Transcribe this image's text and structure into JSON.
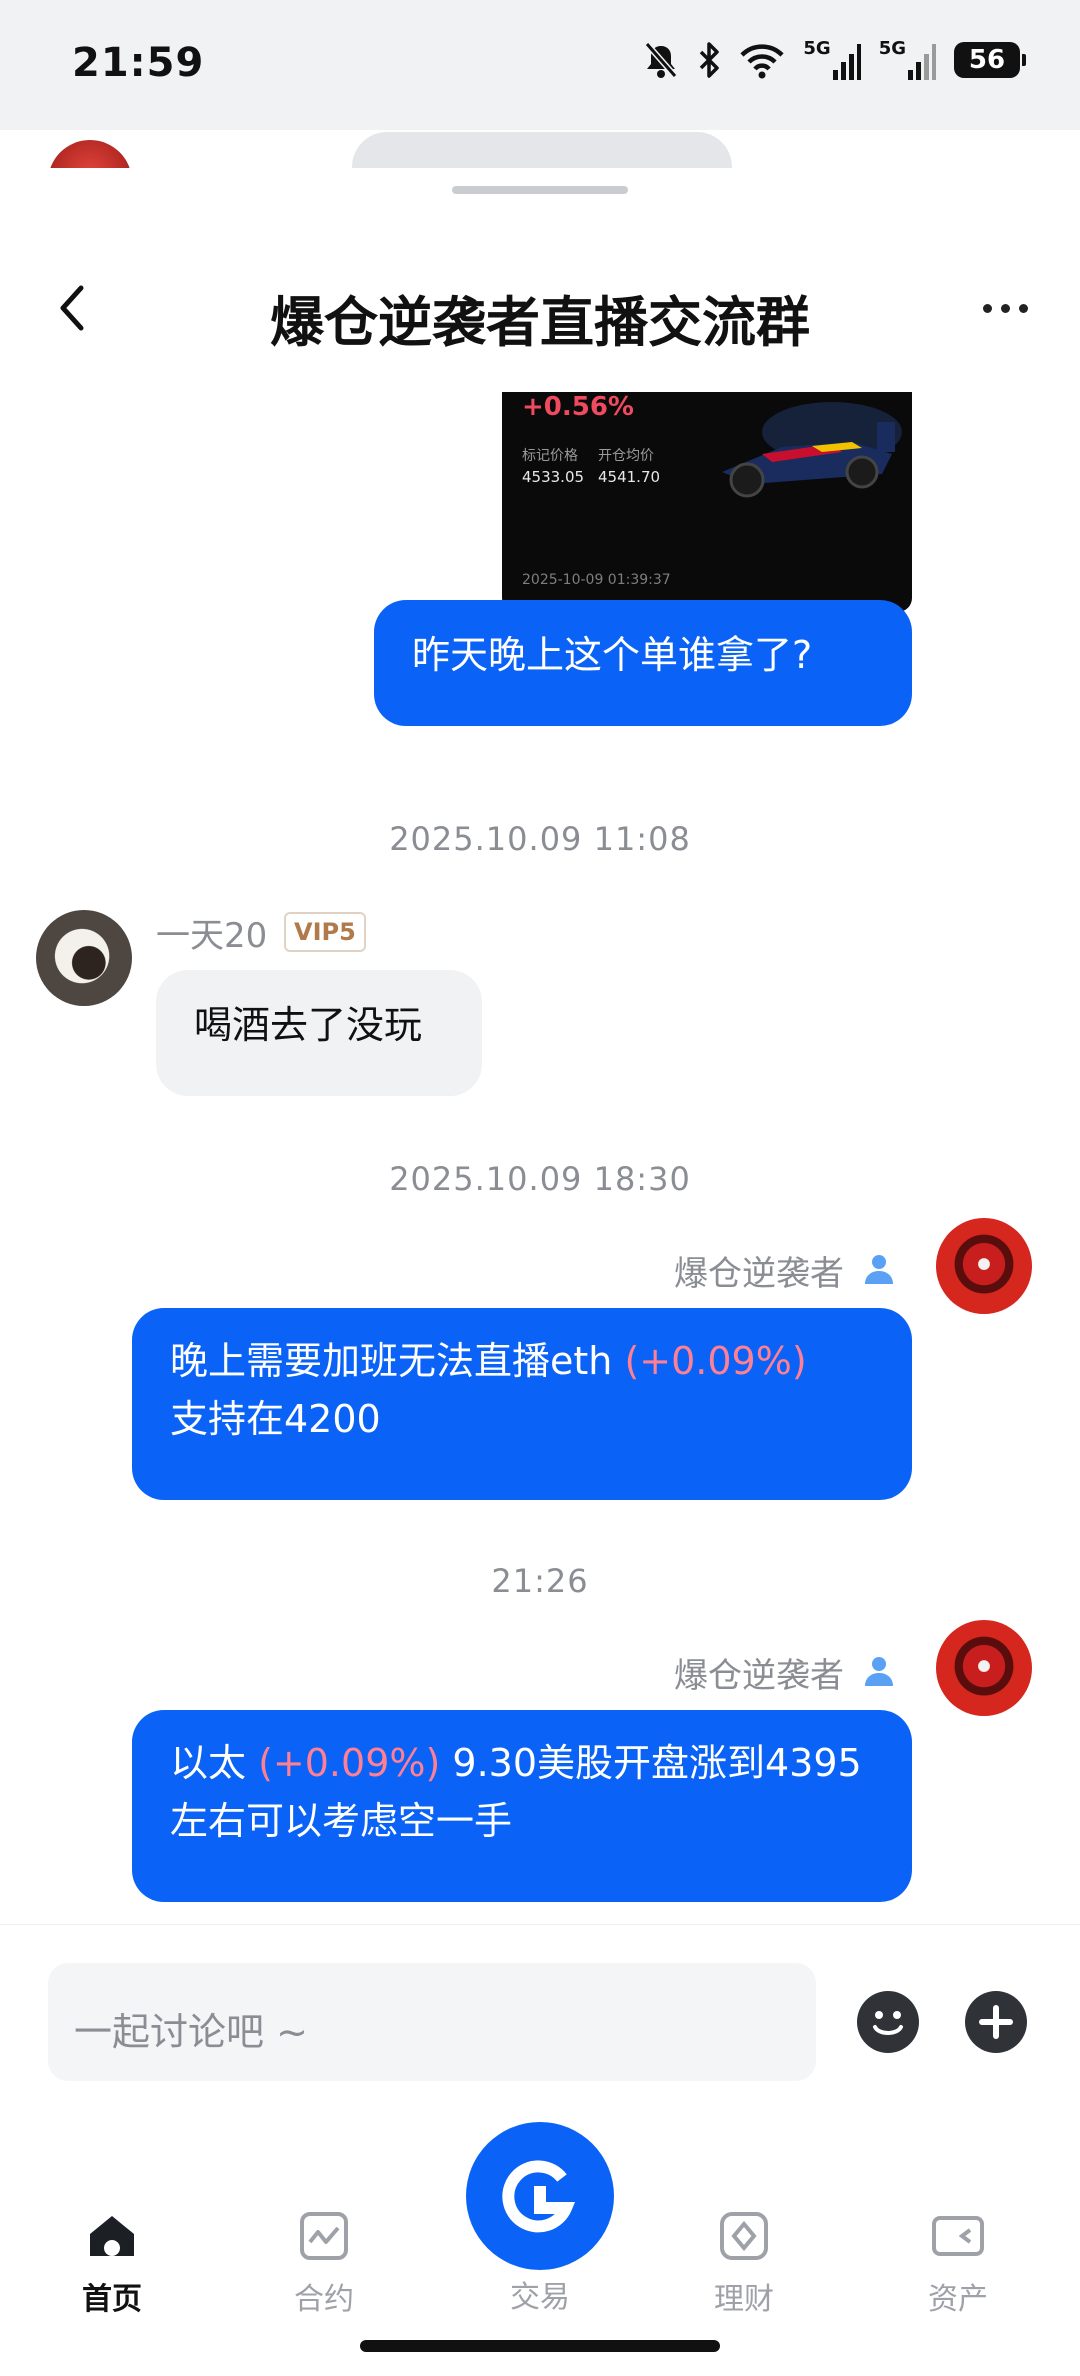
{
  "status_bar": {
    "time": "21:59",
    "network_1": "5G",
    "network_2": "5G",
    "battery": "56"
  },
  "header": {
    "title": "爆仓逆袭者直播交流群"
  },
  "trade_card": {
    "change_pct": "+0.56%",
    "mark_price_label": "标记价格",
    "mark_price": "4533.05",
    "entry_price_label": "开仓均价",
    "entry_price": "4541.70",
    "datetime": "2025-10-09 01:39:37"
  },
  "messages": {
    "m1_text": "昨天晚上这个单谁拿了?",
    "ts1": "2025.10.09 11:08",
    "m2_sender": "一天20",
    "m2_badge": "VIP5",
    "m2_text": "喝酒去了没玩",
    "ts2": "2025.10.09 18:30",
    "m3_sender": "爆仓逆袭者",
    "m3_text_a": "晚上需要加班无法直播eth ",
    "m3_pct": "(+0.09%)",
    "m3_text_b": "支持在4200",
    "ts3": "21:26",
    "m4_sender": "爆仓逆袭者",
    "m4_text_a": "以太 ",
    "m4_pct": "(+0.09%)",
    "m4_text_b": " 9.30美股开盘涨到4395左右可以考虑空一手"
  },
  "input": {
    "placeholder": "一起讨论吧 ~"
  },
  "tabs": {
    "home": "首页",
    "contract": "合约",
    "trade": "交易",
    "finance": "理财",
    "assets": "资产"
  },
  "colors": {
    "accent": "#0a63f6",
    "positive_pct": "#ff7f93",
    "bubble_incoming": "#f1f2f4"
  }
}
